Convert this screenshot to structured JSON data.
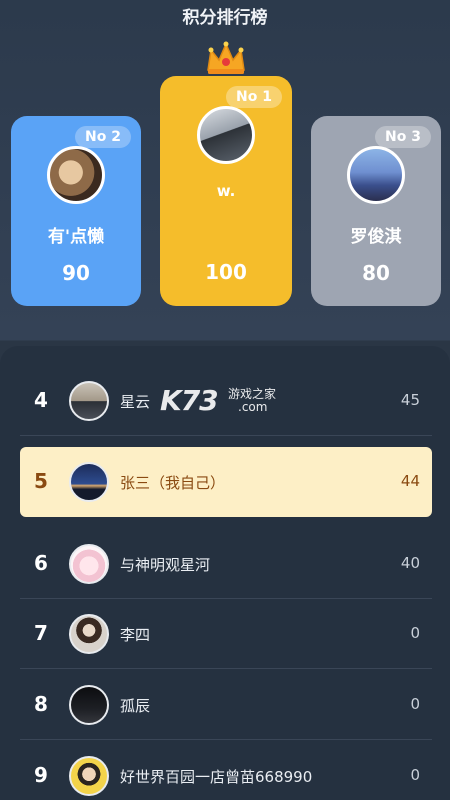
{
  "header": {
    "title": "积分排行榜"
  },
  "podium": {
    "first": {
      "rank_label": "No 1",
      "name": "w.",
      "score": "100",
      "avatar": "avatar-window-photo"
    },
    "second": {
      "rank_label": "No 2",
      "name": "有'点懒",
      "score": "90",
      "avatar": "avatar-dog-photo"
    },
    "third": {
      "rank_label": "No 3",
      "name": "罗俊淇",
      "score": "80",
      "avatar": "avatar-sky-photo"
    }
  },
  "list": [
    {
      "rank": "4",
      "name": "星云",
      "score": "45",
      "avatar": "avatar-person-photo"
    },
    {
      "rank": "5",
      "name": "张三（我自己）",
      "score": "44",
      "avatar": "avatar-night-photo",
      "is_me": true
    },
    {
      "rank": "6",
      "name": "与神明观星河",
      "score": "40",
      "avatar": "avatar-anime-photo"
    },
    {
      "rank": "7",
      "name": "李四",
      "score": "0",
      "avatar": "avatar-girl-photo"
    },
    {
      "rank": "8",
      "name": "孤辰",
      "score": "0",
      "avatar": "avatar-dark-photo"
    },
    {
      "rank": "9",
      "name": "好世界百园一店曾苗668990",
      "score": "0",
      "avatar": "avatar-yellow-photo"
    }
  ],
  "watermark": {
    "brand": "K73",
    "line1": "游戏之家",
    "line2": ".com"
  },
  "colors": {
    "gold": "#f5bd2b",
    "blue": "#5aa3f6",
    "gray": "#9ea5b2",
    "highlight": "#fdefc6"
  }
}
